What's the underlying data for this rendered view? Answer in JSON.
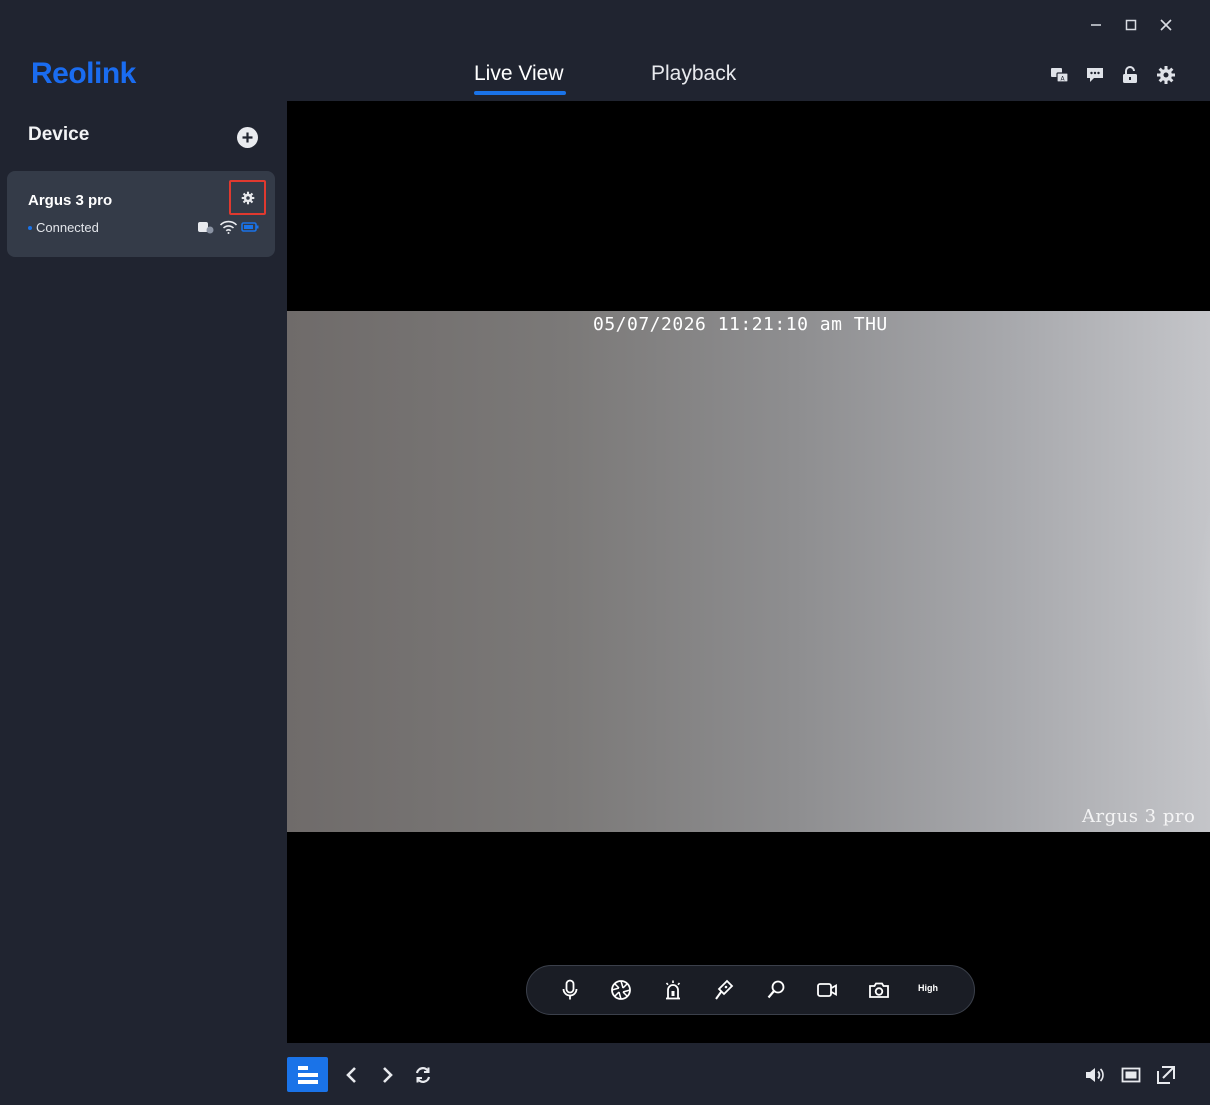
{
  "app": {
    "logo_text": "Reolink",
    "accent_color": "#1a73e8"
  },
  "window_controls": [
    "minimize-icon",
    "maximize-icon",
    "close-icon"
  ],
  "header": {
    "tabs": [
      {
        "label": "Live View",
        "active": true
      },
      {
        "label": "Playback",
        "active": false
      }
    ],
    "icons": [
      "translate-icon",
      "feedback-icon",
      "unlock-icon",
      "gear-icon"
    ]
  },
  "sidebar": {
    "title": "Device",
    "add_icon": "plus-circle-icon",
    "devices": [
      {
        "name": "Argus 3 pro",
        "status": "Connected",
        "status_color": "#1a73e8",
        "icons": [
          "solar-panel-icon",
          "wifi-icon",
          "battery-icon"
        ]
      }
    ]
  },
  "video": {
    "osd_timestamp": "05/07/2026 11:21:10 am THU",
    "osd_camera_name": "Argus 3 pro"
  },
  "controls": {
    "icons": [
      "microphone-icon",
      "aperture-icon",
      "siren-icon",
      "spotlight-icon",
      "zoom-icon",
      "record-icon",
      "snapshot-icon"
    ],
    "quality_label": "High"
  },
  "bottom_bar": {
    "left_icons": [
      "layout-list-icon",
      "previous-icon",
      "next-icon",
      "refresh-icon"
    ],
    "right_icons": [
      "volume-icon",
      "aspect-ratio-icon",
      "fullscreen-icon"
    ]
  }
}
